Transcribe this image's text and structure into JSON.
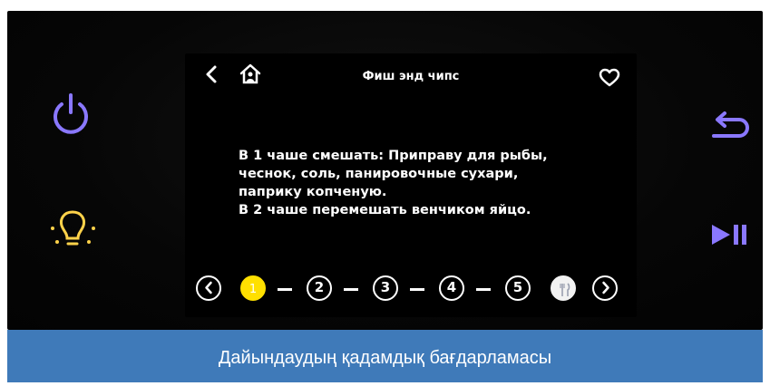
{
  "screen": {
    "title": "Фиш энд чипс",
    "instructions": [
      "В 1 чаше смешать: Приправу для рыбы,",
      "чеснок, соль, панировочные сухари,",
      "паприку копченую.",
      "В 2 чаше перемешать венчиком яйцо."
    ],
    "steps": [
      "1",
      "2",
      "3",
      "4",
      "5"
    ],
    "active_step": "1",
    "final_step_icon": "fork-knife-icon"
  },
  "controls": {
    "left": [
      "power-icon",
      "light-bulb-icon"
    ],
    "right": [
      "undo-icon",
      "play-pause-icon"
    ]
  },
  "footer": {
    "caption": "Дайындаудың қадамдық бағдарламасы"
  },
  "colors": {
    "control_accent": "#8a78ff",
    "active_step": "#ffe000",
    "footer_bg": "#3f7ab9"
  }
}
